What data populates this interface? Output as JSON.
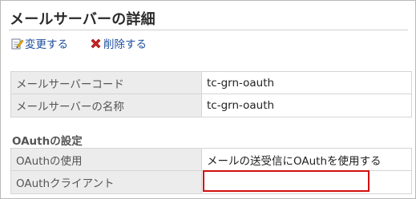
{
  "page": {
    "title": "メールサーバーの詳細"
  },
  "actions": {
    "edit_label": "変更する",
    "delete_label": "削除する"
  },
  "basic": {
    "rows": [
      {
        "label": "メールサーバーコード",
        "value": "tc-grn-oauth"
      },
      {
        "label": "メールサーバーの名称",
        "value": "tc-grn-oauth"
      }
    ]
  },
  "oauth_section": {
    "title": "OAuthの設定",
    "rows": [
      {
        "label": "OAuthの使用",
        "value": "メールの送受信にOAuthを使用する"
      },
      {
        "label": "OAuthクライアント",
        "value": ""
      }
    ]
  },
  "colors": {
    "link": "#1d4f9e",
    "label_bg": "#ececec",
    "highlight": "#d10f0f",
    "delete_icon": "#cc2222"
  },
  "icons": {
    "edit": "pencil-document-icon",
    "delete": "red-x-icon"
  }
}
